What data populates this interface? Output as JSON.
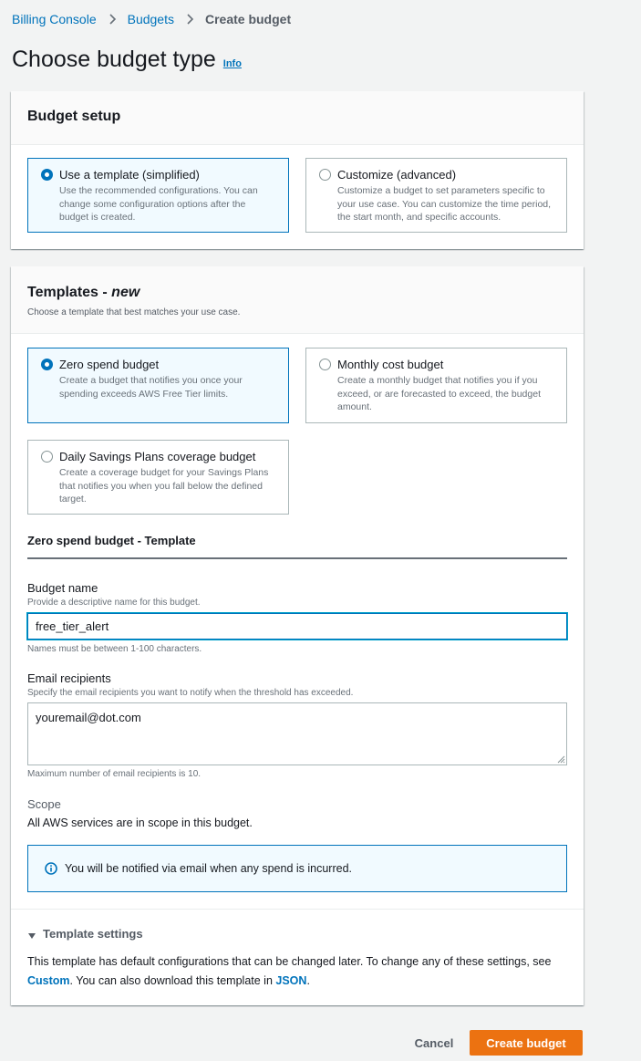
{
  "breadcrumb": {
    "items": [
      "Billing Console",
      "Budgets"
    ],
    "current": "Create budget"
  },
  "page": {
    "title": "Choose budget type",
    "info_label": "Info"
  },
  "budget_setup": {
    "title": "Budget setup",
    "options": [
      {
        "title": "Use a template (simplified)",
        "desc": "Use the recommended configurations. You can change some configuration options after the budget is created.",
        "selected": true
      },
      {
        "title": "Customize (advanced)",
        "desc": "Customize a budget to set parameters specific to your use case. You can customize the time period, the start month, and specific accounts.",
        "selected": false
      }
    ]
  },
  "templates": {
    "title": "Templates - ",
    "title_emphasis": "new",
    "description": "Choose a template that best matches your use case.",
    "options": [
      {
        "title": "Zero spend budget",
        "desc": "Create a budget that notifies you once your spending exceeds AWS Free Tier limits.",
        "selected": true
      },
      {
        "title": "Monthly cost budget",
        "desc": "Create a monthly budget that notifies you if you exceed, or are forecasted to exceed, the budget amount.",
        "selected": false
      },
      {
        "title": "Daily Savings Plans coverage budget",
        "desc": "Create a coverage budget for your Savings Plans that notifies you when you fall below the defined target.",
        "selected": false
      }
    ]
  },
  "template_form": {
    "section_title": "Zero spend budget - Template",
    "budget_name": {
      "label": "Budget name",
      "description": "Provide a descriptive name for this budget.",
      "value": "free_tier_alert",
      "constraint": "Names must be between 1-100 characters."
    },
    "email_recipients": {
      "label": "Email recipients",
      "description": "Specify the email recipients you want to notify when the threshold has exceeded.",
      "value": "youremail@dot.com",
      "constraint": "Maximum number of email recipients is 10."
    },
    "scope": {
      "label": "Scope",
      "value": "All AWS services are in scope in this budget."
    },
    "alert": {
      "text": "You will be notified via email when any spend is incurred.",
      "icon": "info-icon"
    }
  },
  "template_settings": {
    "label": "Template settings",
    "text_before": "This template has default configurations that can be changed later. To change any of these settings, see ",
    "link_custom": "Custom",
    "text_middle": ". You can also download this template in ",
    "link_json": "JSON",
    "text_after": "."
  },
  "actions": {
    "cancel_label": "Cancel",
    "create_label": "Create budget"
  },
  "colors": {
    "link": "#0073bb",
    "primary_button": "#ec7211",
    "selected_tile_bg": "#f1faff"
  }
}
